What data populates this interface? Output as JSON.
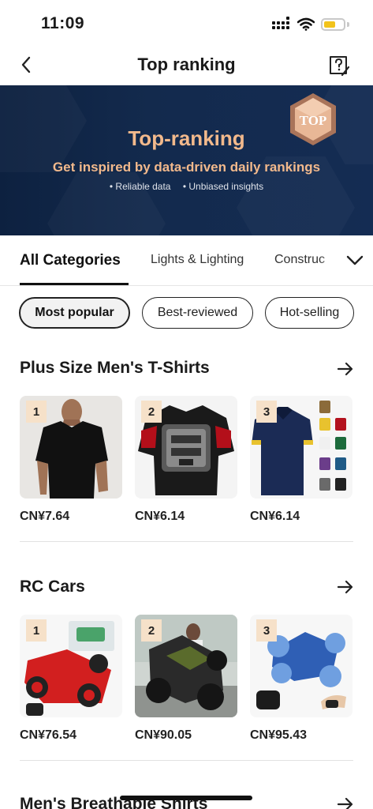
{
  "status_bar": {
    "time": "11:09"
  },
  "header": {
    "title": "Top ranking"
  },
  "banner": {
    "title": "Top-ranking",
    "subtitle": "Get inspired by data-driven daily rankings",
    "bullets": [
      "• Reliable data",
      "• Unbiased insights"
    ],
    "badge_text": "TOP"
  },
  "category_tabs": [
    "All Categories",
    "Lights & Lighting",
    "Construc"
  ],
  "filters": [
    "Most popular",
    "Best-reviewed",
    "Hot-selling"
  ],
  "sections": [
    {
      "title": "Plus Size Men's T-Shirts",
      "products": [
        {
          "rank": "1",
          "price": "CN¥7.64"
        },
        {
          "rank": "2",
          "price": "CN¥6.14"
        },
        {
          "rank": "3",
          "price": "CN¥6.14"
        }
      ]
    },
    {
      "title": "RC Cars",
      "products": [
        {
          "rank": "1",
          "price": "CN¥76.54"
        },
        {
          "rank": "2",
          "price": "CN¥90.05"
        },
        {
          "rank": "3",
          "price": "CN¥95.43"
        }
      ]
    },
    {
      "title": "Men's Breathable Shirts"
    }
  ],
  "colors": {
    "accent": "#f2b98c",
    "banner_bg": "#0d2140",
    "rank_badge": "#f6e1c9",
    "battery": "#f2c31b"
  },
  "icons": [
    "chevron-left-icon",
    "help-icon",
    "chevron-down-icon",
    "arrow-right-icon"
  ]
}
